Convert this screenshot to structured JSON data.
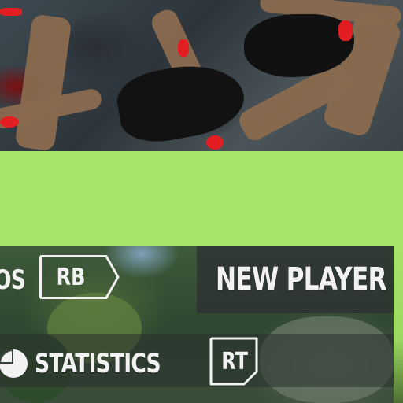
{
  "hud": {
    "partial_label": "OS",
    "bumper_button": "RB",
    "trigger_button": "RT",
    "menu_title": "NEW PLAYER",
    "statistics_label": "STATISTICS",
    "statistics_icon": "pie-chart-icon"
  },
  "colors": {
    "green_band": "#a6e46a",
    "hud_text": "#f2f2f2",
    "accent_red": "#e21e22"
  }
}
